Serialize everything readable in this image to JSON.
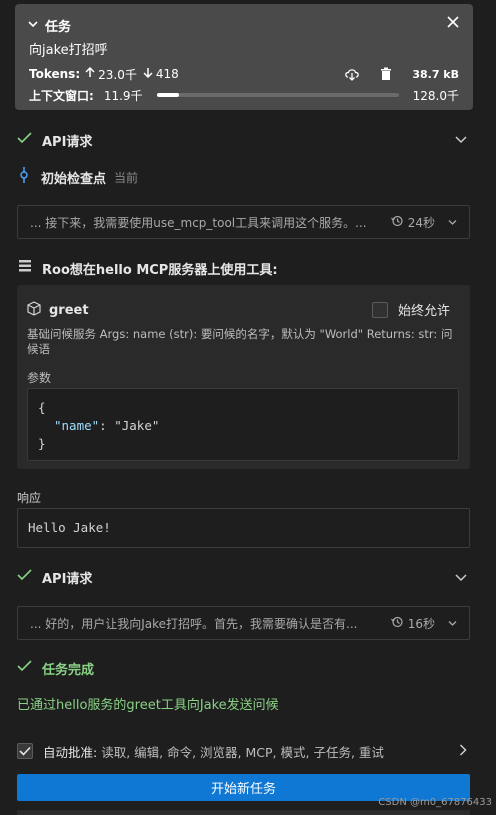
{
  "task": {
    "header_label": "任务",
    "text": "向jake打招呼",
    "tokens_label": "Tokens:",
    "tokens_up": "23.0千",
    "tokens_down": "418",
    "size": "38.7 kB",
    "context_label": "上下文窗口:",
    "context_used": "11.9千",
    "context_max": "128.0千",
    "context_fraction": 0.093
  },
  "api_request_1": {
    "label": "API请求"
  },
  "checkpoint": {
    "label": "初始检查点",
    "status": "当前"
  },
  "thought_1": {
    "text": "... 接下来，我需要使用use_mcp_tool工具来调用这个服务。...",
    "time": "24秒"
  },
  "mcp_notice": {
    "label": "Roo想在hello MCP服务器上使用工具:"
  },
  "tool": {
    "name": "greet",
    "always_allow": "始终允许",
    "description": "基础问候服务 Args: name (str): 要问候的名字，默认为 \"World\" Returns: str: 问候语",
    "params_label": "参数",
    "code_open": "{",
    "code_key": "\"name\"",
    "code_colon": ": ",
    "code_value": "\"Jake\"",
    "code_close": "}"
  },
  "response": {
    "label": "响应",
    "text": "Hello Jake!"
  },
  "api_request_2": {
    "label": "API请求"
  },
  "thought_2": {
    "text": "... 好的，用户让我向Jake打招呼。首先，我需要确认是否有...",
    "time": "16秒"
  },
  "completion": {
    "label": "任务完成",
    "message": "已通过hello服务的greet工具向Jake发送问候"
  },
  "auto_approve": {
    "label": "自动批准:",
    "items": "读取, 编辑, 命令, 浏览器, MCP, 模式, 子任务, 重试"
  },
  "new_task_button": "开始新任务",
  "watermark": "CSDN @m0_67876433"
}
